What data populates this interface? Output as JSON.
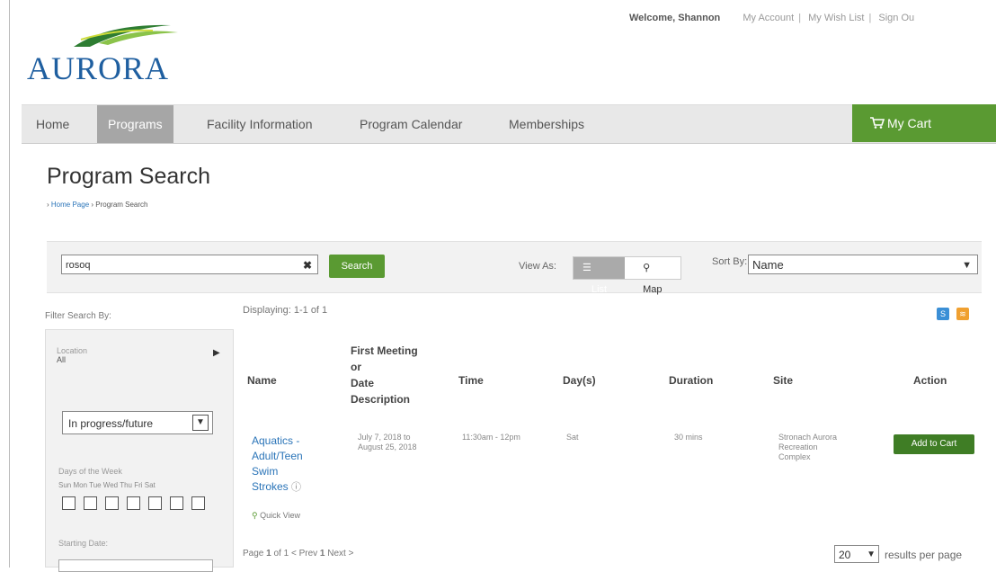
{
  "header": {
    "logo_text": "AURORA",
    "welcome": "Welcome, Shannon",
    "links": [
      "My Account",
      "My Wish List",
      "Sign Ou"
    ]
  },
  "menu": {
    "items": [
      "Home",
      "Programs",
      "Facility Information",
      "Program Calendar",
      "Memberships"
    ],
    "active": "Programs",
    "cart_label": "My Cart"
  },
  "page": {
    "title": "Program Search",
    "breadcrumb": [
      "Home Page",
      "Program Search"
    ]
  },
  "search": {
    "value": "rosoq",
    "clear_glyph": "✖",
    "button": "Search",
    "view_as_label": "View As:",
    "view_list": "List",
    "view_map": "Map",
    "sort_label": "Sort By:",
    "sort_value": "Name"
  },
  "filters": {
    "heading": "Filter Search By:",
    "location_label": "Location",
    "location_value": "All",
    "status_value": "In progress/future",
    "days_label": "Days of the Week",
    "day_names": "Sun Mon Tue Wed Thu Fri  Sat",
    "days_checked": [
      false,
      false,
      false,
      false,
      false,
      false,
      false
    ],
    "start_date_label": "Starting Date:"
  },
  "results": {
    "displaying": "Displaying: 1-1 of 1",
    "headers": {
      "name": "Name",
      "first_meeting": [
        "First Meeting",
        "or",
        "Date",
        "Description"
      ],
      "time": "Time",
      "days": "Day(s)",
      "duration": "Duration",
      "site": "Site",
      "action": "Action"
    },
    "rows": [
      {
        "name": [
          "Aquatics -",
          "Adult/Teen",
          "Swim",
          "Strokes"
        ],
        "dates": [
          "July 7, 2018 to",
          "August 25, 2018"
        ],
        "time": "11:30am - 12pm",
        "days": "Sat",
        "duration": "30 mins",
        "site": [
          "Stronach Aurora",
          "Recreation",
          "Complex"
        ],
        "action": "Add to Cart",
        "quick_view": "Quick View"
      }
    ],
    "pager": {
      "prefix": "Page",
      "current": "1",
      "of_text": "of 1",
      "prev": "< Prev",
      "page_num": "1",
      "next": "Next >"
    },
    "per_page_value": "20",
    "per_page_label": "results per page"
  },
  "colors": {
    "green": "#5a9a32",
    "dark_green": "#3f7d25",
    "link_blue": "#2a74b8",
    "menu_bg": "#e8e8e8"
  }
}
